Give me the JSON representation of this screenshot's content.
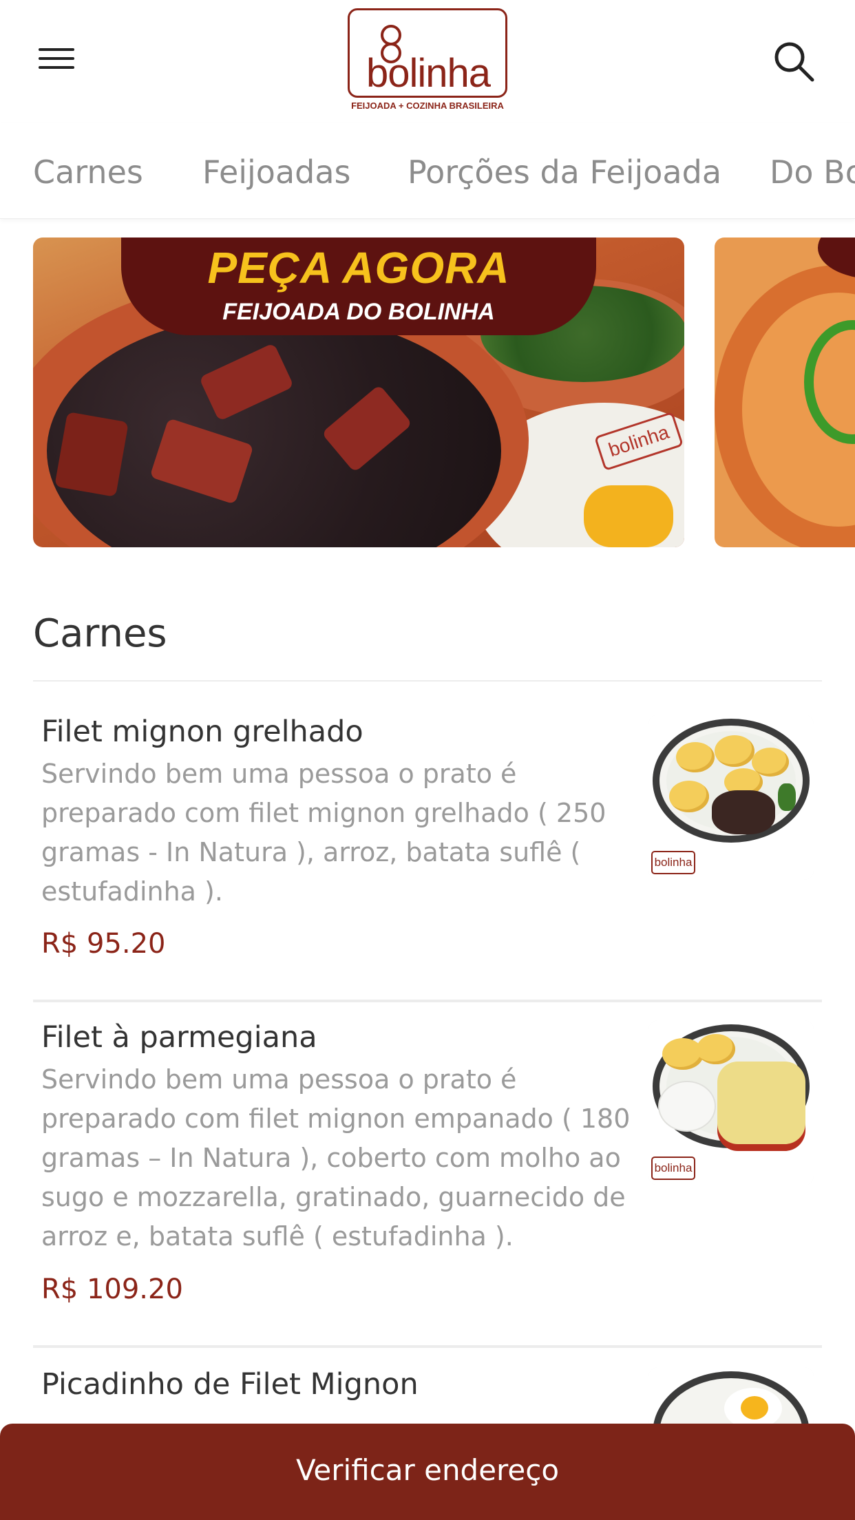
{
  "header": {
    "logo_text": "bolinha",
    "logo_tagline": "FEIJOADA + COZINHA BRASILEIRA",
    "menu_icon": "hamburger-menu-icon",
    "search_icon": "search-icon"
  },
  "tabs": [
    {
      "label": "Carnes"
    },
    {
      "label": "Feijoadas"
    },
    {
      "label": "Porções da Feijoada"
    },
    {
      "label": "Do Bo"
    }
  ],
  "banners": [
    {
      "title": "PEÇA AGORA",
      "subtitle": "FEIJOADA DO BOLINHA",
      "plate_logo": "bolinha"
    }
  ],
  "section": {
    "title": "Carnes"
  },
  "products": [
    {
      "name": "Filet mignon grelhado",
      "description": "Servindo bem uma pessoa o prato é preparado com filet mignon grelhado ( 250 gramas - In Natura ), arroz, batata suflê ( estufadinha ).",
      "price": "R$ 95.20",
      "image_logo": "bolinha"
    },
    {
      "name": "Filet à parmegiana",
      "description": "Servindo bem uma pessoa o prato é preparado com filet mignon empanado ( 180 gramas – In Natura ), coberto com molho ao sugo e mozzarella, gratinado, guarnecido de arroz e, batata suflê ( estufadinha ).",
      "price": "R$ 109.20",
      "image_logo": "bolinha"
    },
    {
      "name": "Picadinho de Filet Mignon"
    }
  ],
  "cta": {
    "label": "Verificar endereço"
  },
  "colors": {
    "brand": "#8b2418",
    "cta_bg": "#7d2418",
    "tab_text": "#8c8c8c",
    "description_text": "#9a9a9a"
  }
}
